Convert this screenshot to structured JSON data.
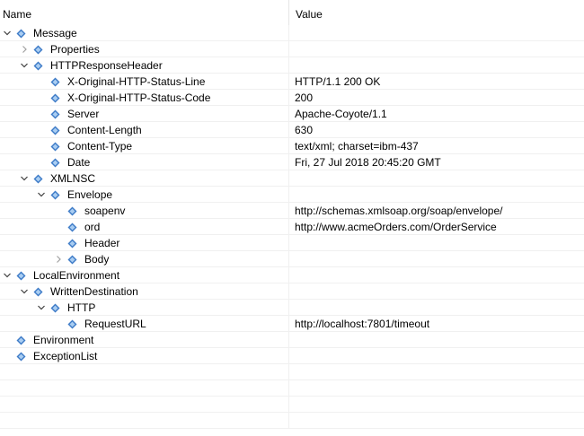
{
  "header": {
    "name_label": "Name",
    "value_label": "Value"
  },
  "rows": [
    {
      "name": "Message",
      "value": "",
      "depth": 0,
      "twisty": "expanded"
    },
    {
      "name": "Properties",
      "value": "",
      "depth": 1,
      "twisty": "collapsed"
    },
    {
      "name": "HTTPResponseHeader",
      "value": "",
      "depth": 1,
      "twisty": "expanded"
    },
    {
      "name": "X-Original-HTTP-Status-Line",
      "value": "HTTP/1.1 200 OK",
      "depth": 2,
      "twisty": "none"
    },
    {
      "name": "X-Original-HTTP-Status-Code",
      "value": "200",
      "depth": 2,
      "twisty": "none"
    },
    {
      "name": "Server",
      "value": "Apache-Coyote/1.1",
      "depth": 2,
      "twisty": "none"
    },
    {
      "name": "Content-Length",
      "value": "630",
      "depth": 2,
      "twisty": "none"
    },
    {
      "name": "Content-Type",
      "value": "text/xml; charset=ibm-437",
      "depth": 2,
      "twisty": "none"
    },
    {
      "name": "Date",
      "value": "Fri, 27 Jul 2018 20:45:20 GMT",
      "depth": 2,
      "twisty": "none"
    },
    {
      "name": "XMLNSC",
      "value": "",
      "depth": 1,
      "twisty": "expanded"
    },
    {
      "name": "Envelope",
      "value": "",
      "depth": 2,
      "twisty": "expanded"
    },
    {
      "name": "soapenv",
      "value": "http://schemas.xmlsoap.org/soap/envelope/",
      "depth": 3,
      "twisty": "none"
    },
    {
      "name": "ord",
      "value": "http://www.acmeOrders.com/OrderService",
      "depth": 3,
      "twisty": "none"
    },
    {
      "name": "Header",
      "value": "",
      "depth": 3,
      "twisty": "none"
    },
    {
      "name": "Body",
      "value": "",
      "depth": 3,
      "twisty": "collapsed"
    },
    {
      "name": "LocalEnvironment",
      "value": "",
      "depth": 0,
      "twisty": "expanded"
    },
    {
      "name": "WrittenDestination",
      "value": "",
      "depth": 1,
      "twisty": "expanded"
    },
    {
      "name": "HTTP",
      "value": "",
      "depth": 2,
      "twisty": "expanded"
    },
    {
      "name": "RequestURL",
      "value": "http://localhost:7801/timeout",
      "depth": 3,
      "twisty": "none"
    },
    {
      "name": "Environment",
      "value": "",
      "depth": 0,
      "twisty": "none"
    },
    {
      "name": "ExceptionList",
      "value": "",
      "depth": 0,
      "twisty": "none"
    }
  ],
  "icons": {
    "expanded": "chevron-down-icon",
    "collapsed": "chevron-right-icon",
    "node": "element-node-icon"
  },
  "colors": {
    "node_icon_fill": "#3d7bc7",
    "node_icon_light": "#a9cdf2",
    "twisty_expanded": "#404040",
    "twisty_collapsed": "#a0a0a0"
  }
}
